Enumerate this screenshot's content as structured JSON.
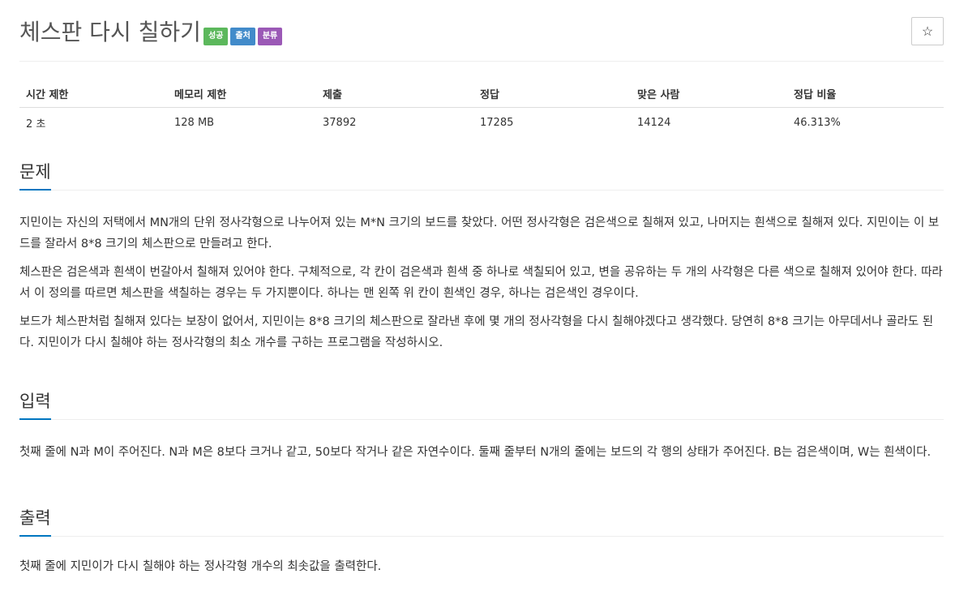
{
  "problem": {
    "title": "체스판 다시 칠하기",
    "badges": [
      {
        "label": "성공",
        "color": "#5cb85c"
      },
      {
        "label": "출처",
        "color": "#428bca"
      },
      {
        "label": "분류",
        "color": "#9b59b6"
      }
    ],
    "star_label": "☆"
  },
  "info_table": {
    "headers": [
      "시간 제한",
      "메모리 제한",
      "제출",
      "정답",
      "맞은 사람",
      "정답 비율"
    ],
    "values": [
      "2 초",
      "128 MB",
      "37892",
      "17285",
      "14124",
      "46.313%"
    ]
  },
  "sections": {
    "description": {
      "heading": "문제",
      "paragraphs": [
        "지민이는 자신의 저택에서 MN개의 단위 정사각형으로 나누어져 있는 M*N 크기의 보드를 찾았다. 어떤 정사각형은 검은색으로 칠해져 있고, 나머지는 흰색으로 칠해져 있다. 지민이는 이 보드를 잘라서 8*8 크기의 체스판으로 만들려고 한다.",
        "체스판은 검은색과 흰색이 번갈아서 칠해져 있어야 한다. 구체적으로, 각 칸이 검은색과 흰색 중 하나로 색칠되어 있고, 변을 공유하는 두 개의 사각형은 다른 색으로 칠해져 있어야 한다. 따라서 이 정의를 따르면 체스판을 색칠하는 경우는 두 가지뿐이다. 하나는 맨 왼쪽 위 칸이 흰색인 경우, 하나는 검은색인 경우이다.",
        "보드가 체스판처럼 칠해져 있다는 보장이 없어서, 지민이는 8*8 크기의 체스판으로 잘라낸 후에 몇 개의 정사각형을 다시 칠해야겠다고 생각했다. 당연히 8*8 크기는 아무데서나 골라도 된다. 지민이가 다시 칠해야 하는 정사각형의 최소 개수를 구하는 프로그램을 작성하시오."
      ]
    },
    "input": {
      "heading": "입력",
      "paragraphs": [
        "첫째 줄에 N과 M이 주어진다. N과 M은 8보다 크거나 같고, 50보다 작거나 같은 자연수이다. 둘째 줄부터 N개의 줄에는 보드의 각 행의 상태가 주어진다. B는 검은색이며, W는 흰색이다."
      ]
    },
    "output": {
      "heading": "출력",
      "paragraphs": [
        "첫째 줄에 지민이가 다시 칠해야 하는 정사각형 개수의 최솟값을 출력한다."
      ]
    }
  }
}
